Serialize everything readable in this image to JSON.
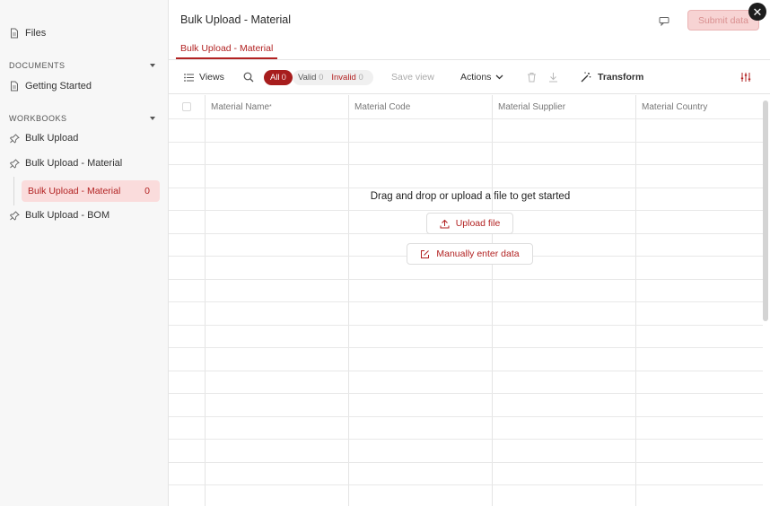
{
  "sidebar": {
    "files_label": "Files",
    "documents_heading": "DOCUMENTS",
    "documents": [
      {
        "label": "Getting Started"
      }
    ],
    "workbooks_heading": "WORKBOOKS",
    "workbooks": [
      {
        "label": "Bulk Upload"
      },
      {
        "label": "Bulk Upload - Material"
      },
      {
        "label": "Bulk Upload - BOM"
      }
    ],
    "active_sheet": {
      "label": "Bulk Upload - Material",
      "count": "0"
    }
  },
  "header": {
    "title": "Bulk Upload - Material",
    "submit_label": "Submit data",
    "close_glyph": "✕",
    "tab_label": "Bulk Upload - Material"
  },
  "toolbar": {
    "views_label": "Views",
    "filter_all_label": "All",
    "filter_all_count": "0",
    "filter_valid_label": "Valid",
    "filter_valid_count": "0",
    "filter_invalid_label": "Invalid",
    "filter_invalid_count": "0",
    "save_view_label": "Save view",
    "actions_label": "Actions",
    "transform_label": "Transform"
  },
  "grid": {
    "columns": [
      {
        "label": "Material Name",
        "required_marker": "*"
      },
      {
        "label": "Material Code"
      },
      {
        "label": "Material Supplier"
      },
      {
        "label": "Material Country"
      }
    ]
  },
  "empty_state": {
    "message": "Drag and drop or upload a file to get started",
    "upload_label": "Upload file",
    "manual_label": "Manually enter data"
  },
  "colors": {
    "accent": "#b22222",
    "accent_dark": "#a71d1d",
    "active_bg": "#fadcdc"
  },
  "icons": [
    "file-icon",
    "document-icon",
    "pin-icon",
    "list-icon",
    "search-icon",
    "chevron-down-icon",
    "trash-icon",
    "download-icon",
    "magic-wand-icon",
    "sliders-icon",
    "feedback-icon",
    "upload-icon",
    "edit-icon",
    "close-icon"
  ]
}
